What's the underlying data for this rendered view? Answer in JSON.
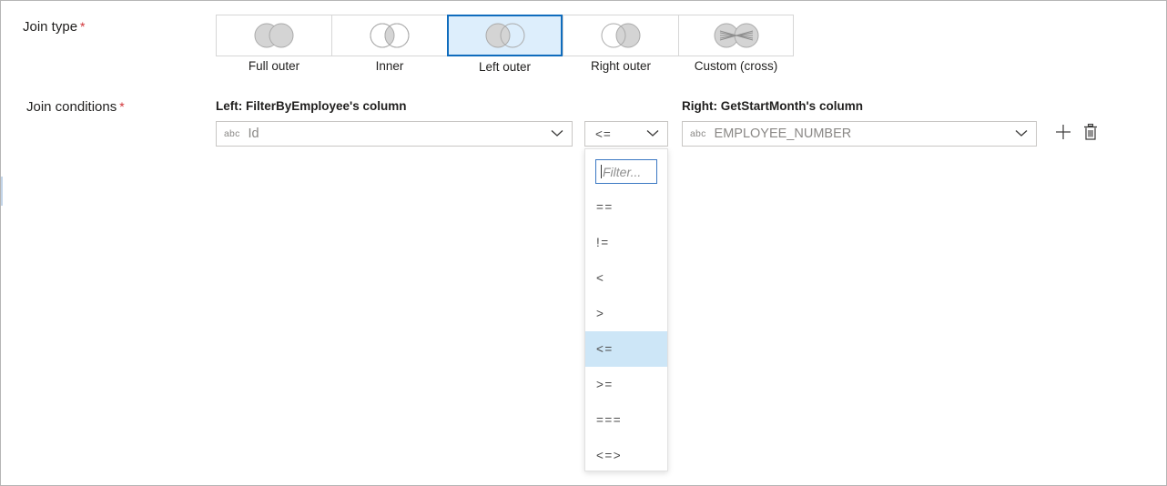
{
  "form": {
    "join_type_label": "Join type",
    "join_conditions_label": "Join conditions",
    "required_marker": "*"
  },
  "join_types": {
    "selected": "Left outer",
    "options": [
      {
        "label": "Full outer",
        "icon": "venn-full-outer-icon"
      },
      {
        "label": "Inner",
        "icon": "venn-inner-icon"
      },
      {
        "label": "Left outer",
        "icon": "venn-left-outer-icon"
      },
      {
        "label": "Right outer",
        "icon": "venn-right-outer-icon"
      },
      {
        "label": "Custom (cross)",
        "icon": "venn-custom-cross-icon"
      }
    ]
  },
  "join_conditions": {
    "left_header": "Left: FilterByEmployee's column",
    "right_header": "Right: GetStartMonth's column",
    "left_column": {
      "type_badge": "abc",
      "value": "Id",
      "chevron_icon": "chevron-down-icon"
    },
    "operator": {
      "value": "<=",
      "chevron_icon": "chevron-down-icon"
    },
    "right_column": {
      "type_badge": "abc",
      "value": "EMPLOYEE_NUMBER",
      "chevron_icon": "chevron-down-icon"
    },
    "add_icon": "plus-icon",
    "delete_icon": "trash-icon"
  },
  "operator_dropdown": {
    "open": true,
    "filter_placeholder": "Filter...",
    "selected": "<=",
    "options": [
      "==",
      "!=",
      "<",
      ">",
      "<=",
      ">=",
      "===",
      "<=>"
    ]
  },
  "colors": {
    "accent": "#0f6cbd",
    "selected_tile_bg": "#ddeefc",
    "selected_item_bg": "#cde6f7",
    "required_star": "#d13438",
    "border": "#c8c6c4",
    "muted_text": "#8a8886"
  }
}
